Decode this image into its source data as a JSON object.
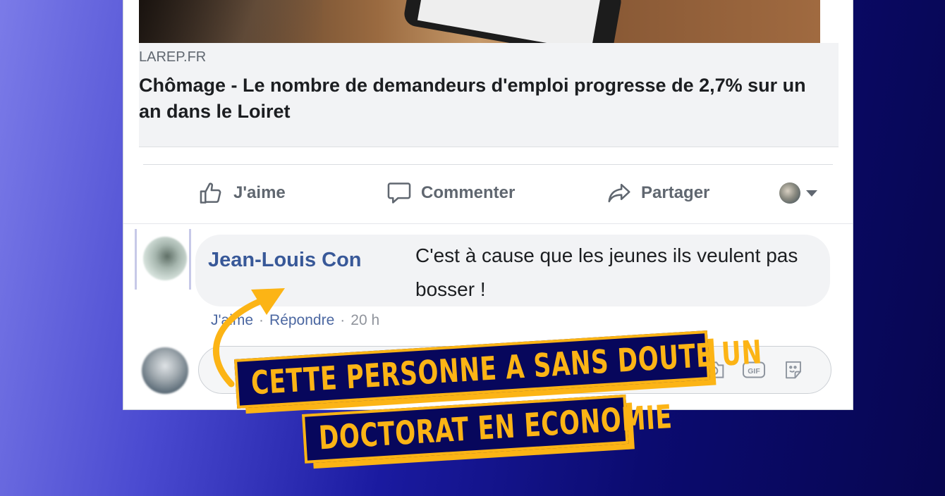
{
  "post": {
    "link_source": "LAREP.FR",
    "link_title": "Chômage - Le nombre de demandeurs d'emploi progresse de 2,7% sur un an dans le Loiret"
  },
  "actions": {
    "like_label": "J'aime",
    "comment_label": "Commenter",
    "share_label": "Partager"
  },
  "comment": {
    "author": "Jean-Louis Con",
    "text": "C'est à cause que les jeunes ils veulent pas bosser !",
    "like_label": "J'aime",
    "reply_label": "Répondre",
    "separator": "·",
    "time": "20 h"
  },
  "composer": {
    "icons": [
      "camera-icon",
      "gif-icon",
      "sticker-icon"
    ]
  },
  "overlay": {
    "line1": "CETTE PERSONNE A SANS DOUTE UN",
    "line2": "DOCTORAT EN ECONOMIE",
    "accent_color": "#fcb415",
    "panel_color": "#07075c"
  },
  "colors": {
    "link_blue": "#385898",
    "text_gray": "#606770"
  }
}
